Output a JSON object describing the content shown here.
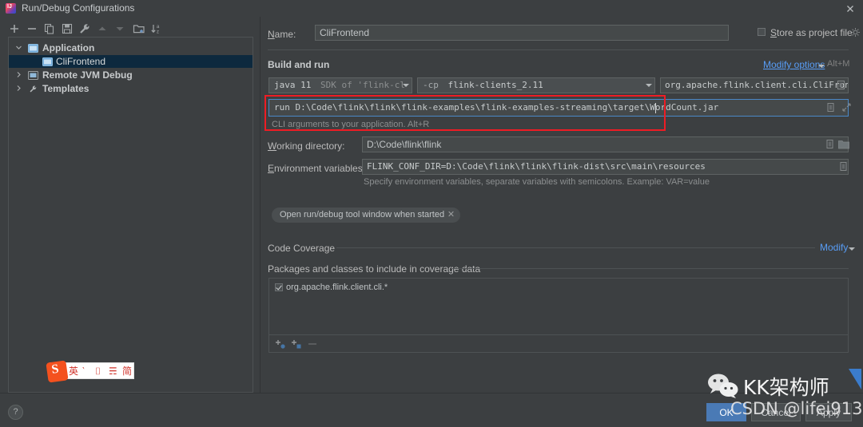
{
  "window": {
    "title": "Run/Debug Configurations",
    "app_icon": "intellij-idea-icon",
    "close_icon": "close-icon"
  },
  "sidebar": {
    "toolbar": [
      {
        "name": "add-configuration-button",
        "icon": "plus-icon"
      },
      {
        "name": "remove-configuration-button",
        "icon": "minus-icon"
      },
      {
        "name": "copy-configuration-button",
        "icon": "copy-icon"
      },
      {
        "name": "save-configuration-button",
        "icon": "save-icon"
      },
      {
        "name": "edit-templates-button",
        "icon": "wrench-icon"
      },
      {
        "name": "move-up-button",
        "icon": "arrow-up-icon"
      },
      {
        "name": "move-down-button",
        "icon": "arrow-down-icon"
      },
      {
        "name": "move-into-folder-button",
        "icon": "folder-add-icon"
      },
      {
        "name": "sort-configurations-button",
        "icon": "sort-az-icon"
      }
    ],
    "tree": [
      {
        "label": "Application",
        "level": 0,
        "expanded": true,
        "icon": "application-icon",
        "selected": false
      },
      {
        "label": "CliFrontend",
        "level": 1,
        "expanded": null,
        "icon": "run-config-icon",
        "selected": true
      },
      {
        "label": "Remote JVM Debug",
        "level": 0,
        "expanded": false,
        "icon": "remote-debug-icon",
        "selected": false
      },
      {
        "label": "Templates",
        "level": 0,
        "expanded": false,
        "icon": "wrench-icon",
        "selected": false
      }
    ]
  },
  "main": {
    "name_label": "Name:",
    "name_value": "CliFrontend",
    "store_as_project_file_label": "Store as project file",
    "store_as_project_file_checked": false,
    "store_gear_icon": "gear-icon",
    "build_and_run_title": "Build and run",
    "modify_options_link": "Modify options",
    "modify_options_shortcut": "Alt+M",
    "jre_combo": {
      "main": "java 11",
      "secondary": "SDK of 'flink-cl",
      "caret_icon": "chevron-down-icon"
    },
    "classpath_combo": {
      "prefix": "-cp",
      "value": "flink-clients_2.11",
      "caret_icon": "chevron-down-icon"
    },
    "main_class": {
      "value": "org.apache.flink.client.cli.CliFrontend",
      "browse_icon": "browse-class-icon"
    },
    "program_arguments": {
      "value": "run D:\\Code\\flink\\flink\\flink-examples\\flink-examples-streaming\\target\\WordCount.jar",
      "hint": "CLI arguments to your application. Alt+R",
      "macro_icon": "insert-macro-icon",
      "expand_icon": "expand-editor-icon",
      "focused": true,
      "highlight_color": "#ee1c24"
    },
    "working_directory": {
      "label": "Working directory:",
      "value": "D:\\Code\\flink\\flink",
      "macro_icon": "insert-macro-icon",
      "browse_icon": "folder-icon"
    },
    "environment_variables": {
      "label": "Environment variables:",
      "value": "FLINK_CONF_DIR=D:\\Code\\flink\\flink\\flink-dist\\src\\main\\resources",
      "hint": "Specify environment variables, separate variables with semicolons. Example: VAR=value",
      "browse_icon": "browse-env-icon"
    },
    "option_chip": {
      "label": "Open run/debug tool window when started",
      "remove_icon": "close-small-icon"
    },
    "code_coverage": {
      "title": "Code Coverage",
      "modify_link": "Modify",
      "packages_label": "Packages and classes to include in coverage data",
      "items": [
        {
          "label": "org.apache.flink.client.cli.*",
          "checked": true
        }
      ],
      "toolbar": [
        {
          "name": "add-package-button",
          "icon": "add-package-icon"
        },
        {
          "name": "add-class-button",
          "icon": "add-class-icon"
        },
        {
          "name": "remove-pattern-button",
          "icon": "minus-icon"
        }
      ]
    }
  },
  "footer": {
    "help_icon": "help-icon",
    "buttons": [
      {
        "label": "OK",
        "primary": true
      },
      {
        "label": "Cancel",
        "primary": false
      },
      {
        "label": "Apply",
        "primary": false
      }
    ]
  },
  "ime_widget": {
    "logo": "sogou-ime-icon",
    "glyphs": [
      "英",
      "‵",
      "⌷",
      "☴",
      "简"
    ]
  },
  "watermark": {
    "icon": "wechat-icon",
    "title": "KK架构师",
    "subtitle": "CSDN @lifei913"
  },
  "theme": {
    "background": "#3c3f41",
    "field_background": "#45494a",
    "accent_blue": "#589df6",
    "selection": "#0d293e",
    "annotation_red": "#ee1c24",
    "primary_button": "#4a7ab5"
  }
}
